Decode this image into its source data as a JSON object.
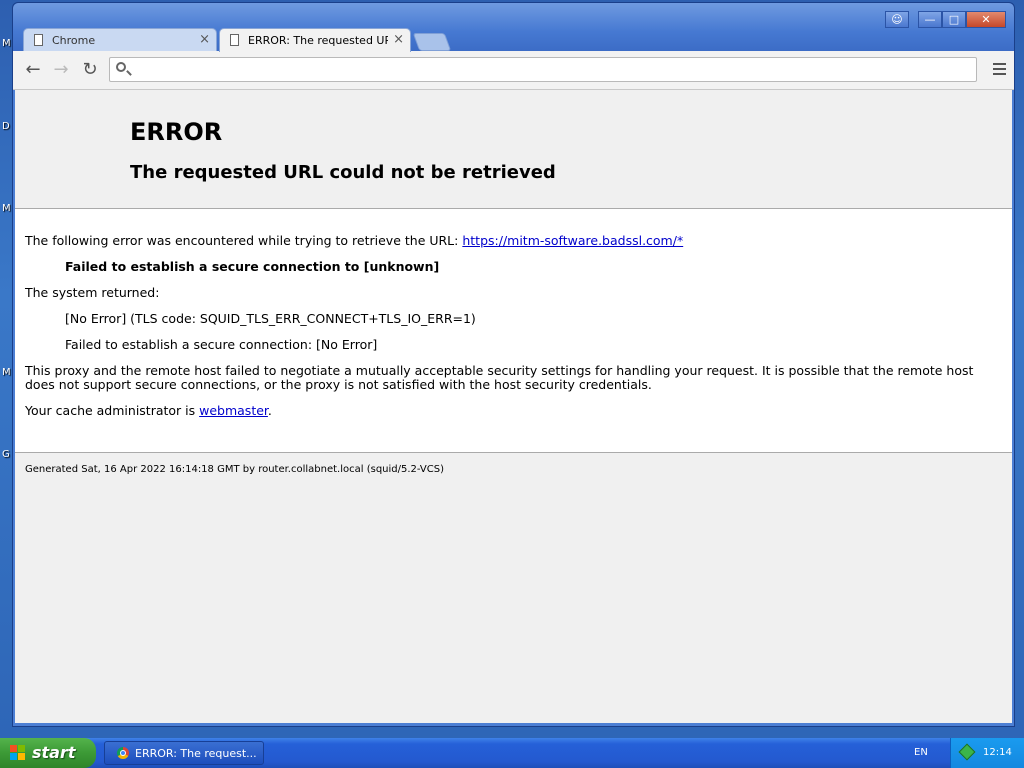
{
  "desktop": {
    "icon_letters": [
      "M",
      "D",
      "M",
      "M",
      "G"
    ]
  },
  "window": {
    "tabs": [
      {
        "label": "Chrome",
        "active": false
      },
      {
        "label": "ERROR: The requested URL",
        "active": true
      }
    ],
    "controls": {
      "profile": "☺",
      "minimize": "—",
      "maximize": "□",
      "close": "✕"
    },
    "toolbar": {
      "back": "←",
      "forward": "→",
      "reload": "↻",
      "omnibox_value": ""
    }
  },
  "page": {
    "title": "ERROR",
    "subtitle": "The requested URL could not be retrieved",
    "intro_text": "The following error was encountered while trying to retrieve the URL: ",
    "url_link": "https://mitm-software.badssl.com/*",
    "error_bold": "Failed to establish a secure connection to [unknown]",
    "system_returned": "The system returned:",
    "tls_code": "[No Error] (TLS code: SQUID_TLS_ERR_CONNECT+TLS_IO_ERR=1)",
    "secure_conn": "Failed to establish a secure connection: [No Error]",
    "proxy_line1": "This proxy and the remote host failed to negotiate a mutually acceptable security settings for handling your request. It is possible that the remote host",
    "proxy_line2": "does not support secure connections, or the proxy is not satisfied with the host security credentials.",
    "admin_text": "Your cache administrator is ",
    "admin_link": "webmaster",
    "admin_suffix": ".",
    "footer": "Generated Sat, 16 Apr 2022 16:14:18 GMT by router.collabnet.local (squid/5.2-VCS)"
  },
  "taskbar": {
    "start_label": "start",
    "task_label": "ERROR: The request...",
    "language": "EN",
    "clock": "12:14"
  },
  "colors": {
    "link": "#0000cc",
    "taskbar": "#2459cf",
    "start": "#3c9a36"
  }
}
